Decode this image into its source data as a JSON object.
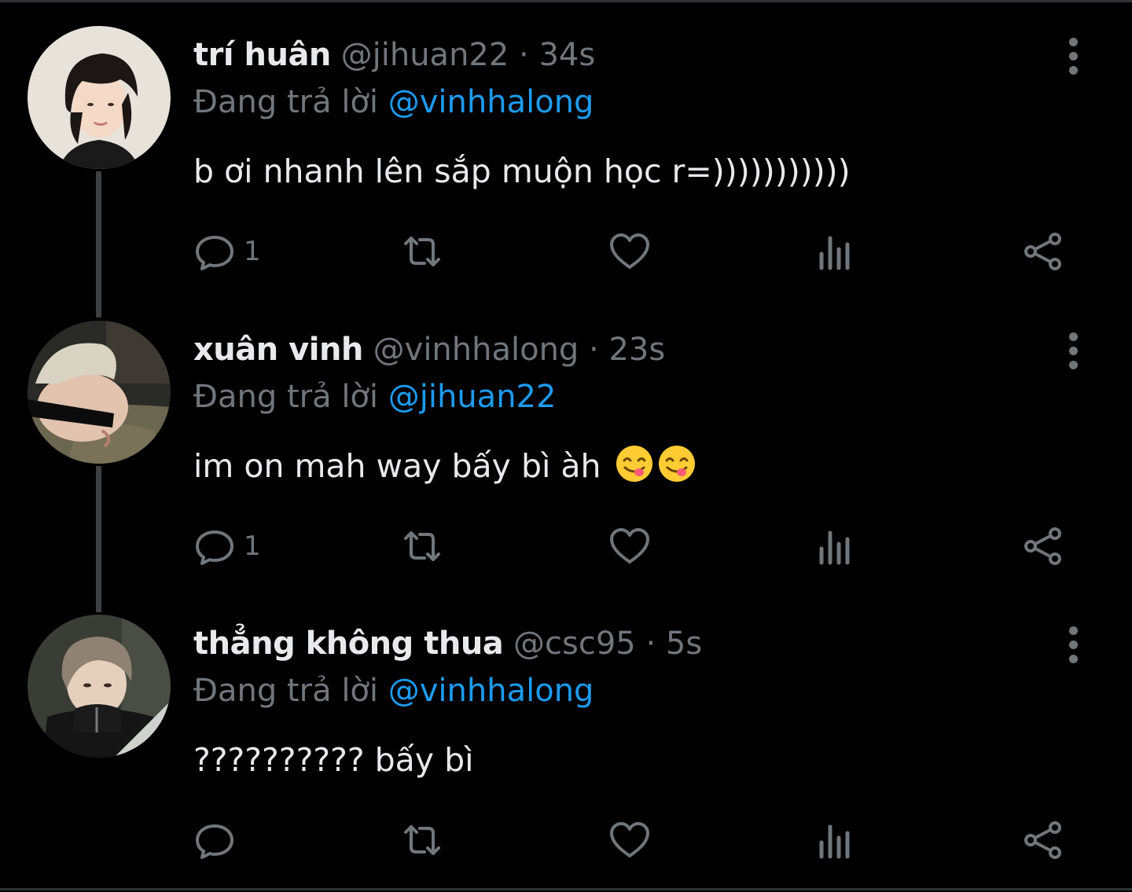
{
  "colors": {
    "background": "#000000",
    "text": "#e7e9ea",
    "muted": "#71767b",
    "accent": "#1d9bf0"
  },
  "replying_label": "Đang trả lời",
  "tweets": [
    {
      "name": "trí huân",
      "handle": "@jihuan22",
      "time": "34s",
      "replying_to": "@vinhhalong",
      "text": "b ơi nhanh lên sắp muộn học r=)))))))))))",
      "emoji": [],
      "reply_count": "1"
    },
    {
      "name": "xuân vinh",
      "handle": "@vinhhalong",
      "time": "23s",
      "replying_to": "@jihuan22",
      "text": "im on mah way bấy bì àh",
      "emoji": [
        "face-savoring-food-emoji",
        "face-savoring-food-emoji"
      ],
      "reply_count": "1"
    },
    {
      "name": "thẳng không thua",
      "handle": "@csc95",
      "time": "5s",
      "replying_to": "@vinhhalong",
      "text": "?????????? bấy bì",
      "emoji": [],
      "reply_count": ""
    }
  ],
  "icons": [
    "reply-icon",
    "retweet-icon",
    "like-icon",
    "views-icon",
    "share-icon",
    "more-options-icon"
  ]
}
